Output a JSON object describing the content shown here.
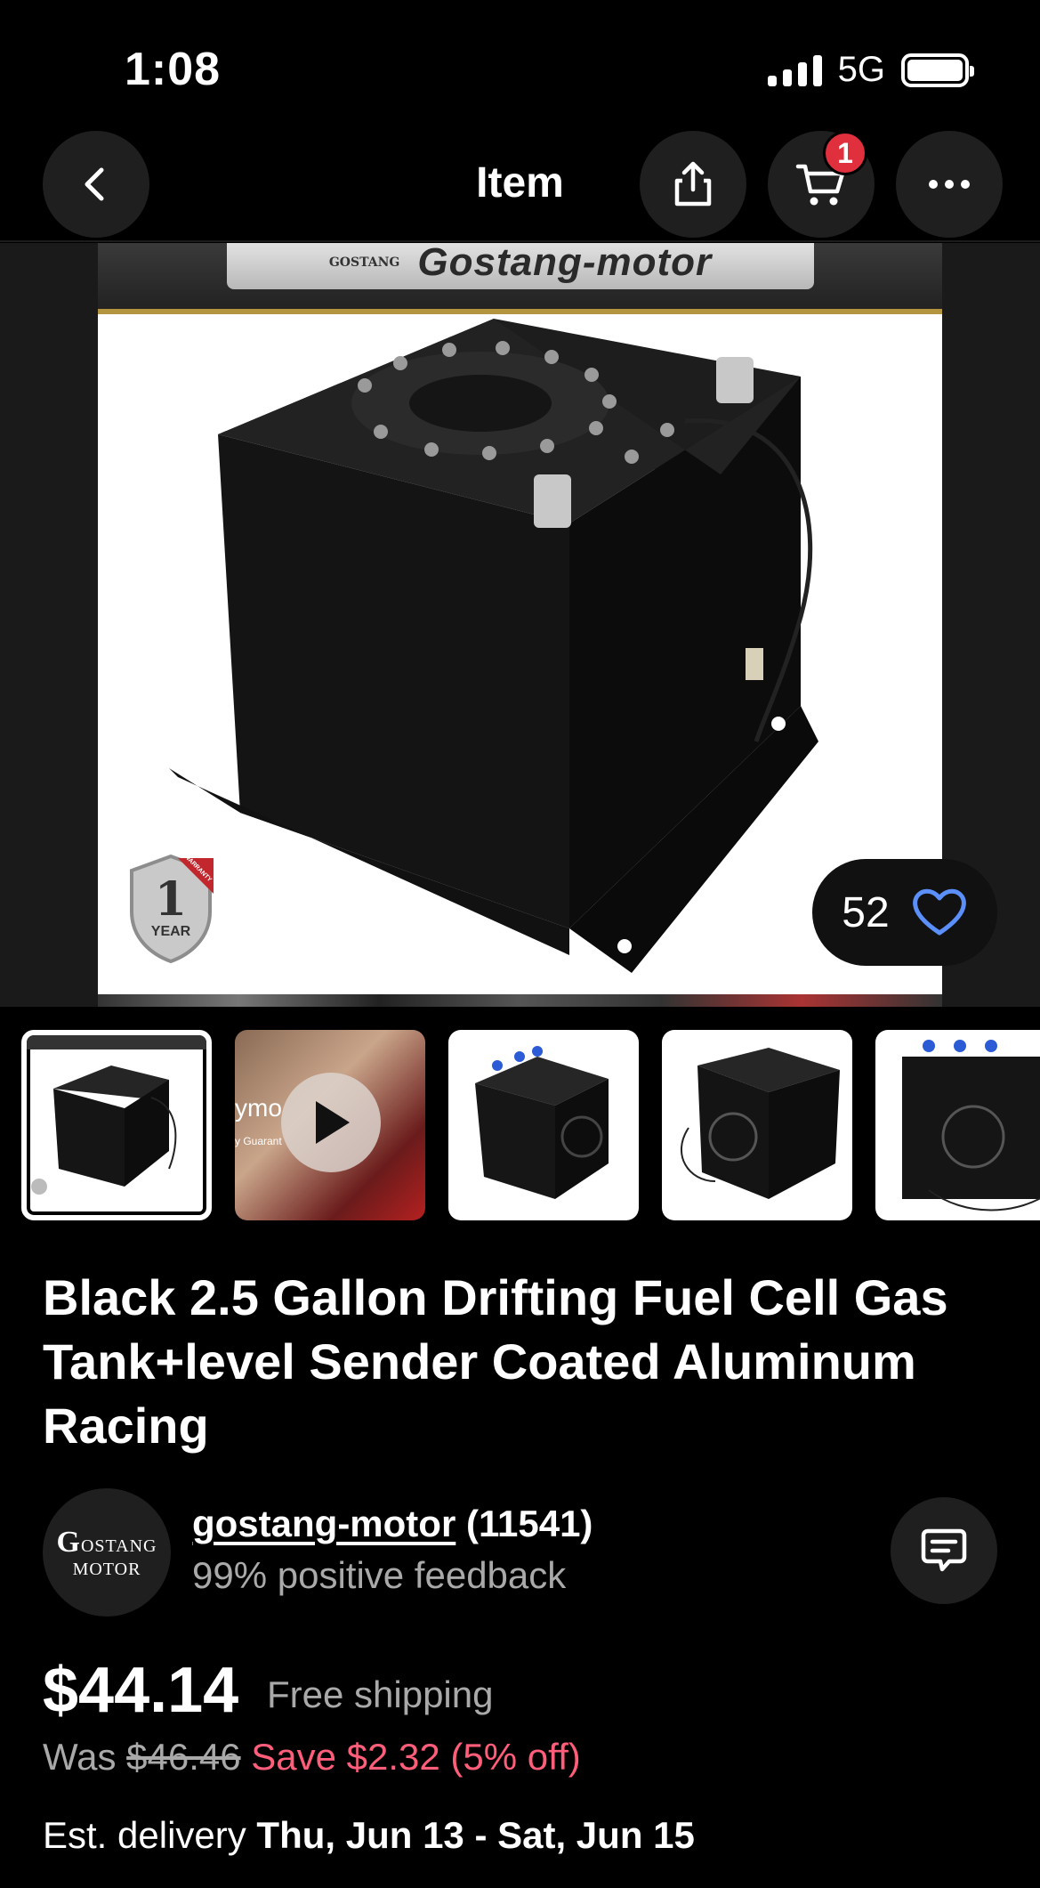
{
  "status_bar": {
    "time": "1:08",
    "network": "5G"
  },
  "nav": {
    "title": "Item",
    "cart_count": "1"
  },
  "hero": {
    "plate_small": "GOSTANG",
    "plate_big": "Gostang-motor",
    "badge_number": "1",
    "badge_label": "YEAR",
    "badge_ribbon": "WARRANTY",
    "likes": "52"
  },
  "thumbnails": {
    "video_text_1": "ymo",
    "video_text_2": "y Guarant"
  },
  "item": {
    "title": "Black 2.5 Gallon Drifting Fuel Cell Gas Tank+level Sender Coated Aluminum Racing"
  },
  "seller": {
    "avatar_line1_initial": "G",
    "avatar_line1_rest": "OSTANG",
    "avatar_line2": "MOTOR",
    "name": "gostang-motor",
    "count": "(11541)",
    "feedback": "99% positive feedback"
  },
  "pricing": {
    "price": "$44.14",
    "shipping": "Free shipping",
    "was_label": "Was",
    "was_price": "$46.46",
    "save": "Save $2.32 (5% off)"
  },
  "delivery": {
    "label": "Est. delivery",
    "dates": "Thu, Jun 13 - Sat, Jun 15"
  }
}
